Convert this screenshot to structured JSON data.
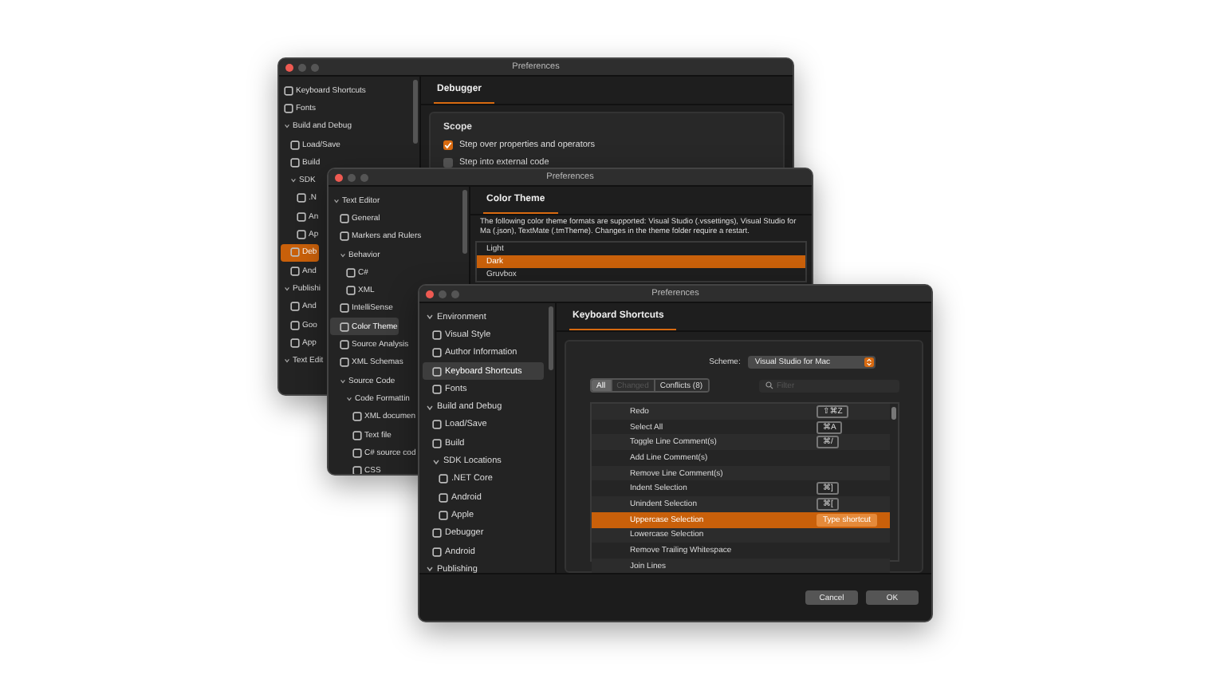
{
  "windows": [
    {
      "title": "Preferences",
      "sidebar": [
        {
          "label": "Keyboard Shortcuts",
          "selected": false
        },
        {
          "label": "Fonts",
          "selected": false
        },
        {
          "label": "Build and Debug",
          "selected": false,
          "expanded": true,
          "children": [
            {
              "label": "Load/Save",
              "selected": false
            },
            {
              "label": "Build",
              "selected": false
            },
            {
              "label": "SDK",
              "selected": false,
              "expanded": true,
              "children": [
                {
                  "label": ".N",
                  "selected": false
                },
                {
                  "label": "An",
                  "selected": false
                },
                {
                  "label": "Ap",
                  "selected": false
                }
              ]
            },
            {
              "label": "Deb",
              "selected": true
            },
            {
              "label": "And",
              "selected": false
            }
          ]
        },
        {
          "label": "Publishi",
          "selected": false,
          "expanded": true,
          "children": [
            {
              "label": "And",
              "selected": false
            },
            {
              "label": "Goo",
              "selected": false
            },
            {
              "label": "App",
              "selected": false
            }
          ]
        },
        {
          "label": "Text Edit",
          "selected": false,
          "expanded": true
        }
      ],
      "page": {
        "kind": "options",
        "tab": "Debugger",
        "section": "Scope",
        "options": [
          {
            "label": "Step over properties and operators",
            "checked": true
          },
          {
            "label": "Step into external code",
            "checked": false
          }
        ]
      }
    },
    {
      "title": "Preferences",
      "sidebar": [
        {
          "label": "Text Editor",
          "selected": false,
          "expanded": true,
          "children": [
            {
              "label": "General",
              "selected": false
            },
            {
              "label": "Markers and Rulers",
              "selected": false
            },
            {
              "label": "Behavior",
              "selected": false,
              "expanded": true,
              "children": [
                {
                  "label": "C#",
                  "selected": false
                },
                {
                  "label": "XML",
                  "selected": false
                }
              ]
            },
            {
              "label": "IntelliSense",
              "selected": false
            },
            {
              "label": "Color Theme",
              "selected": true
            },
            {
              "label": "Source Analysis",
              "selected": false
            },
            {
              "label": "XML Schemas",
              "selected": false
            },
            {
              "label": "Source Code",
              "selected": false,
              "expanded": true,
              "children": [
                {
                  "label": "Code Formattin",
                  "selected": false,
                  "expanded": true,
                  "children": [
                    {
                      "label": "XML documen",
                      "selected": false
                    },
                    {
                      "label": "Text file",
                      "selected": false
                    },
                    {
                      "label": "C# source cod",
                      "selected": false
                    },
                    {
                      "label": "CSS",
                      "selected": false
                    }
                  ]
                }
              ]
            }
          ]
        }
      ],
      "page": {
        "kind": "theme",
        "tab": "Color Theme",
        "description": "The following color theme formats are supported: Visual Studio (.vssettings), Visual Studio for Ma (.json), TextMate (.tmTheme). Changes in the theme folder require a restart.",
        "themes": [
          {
            "label": "Light",
            "selected": false
          },
          {
            "label": "Dark",
            "selected": true
          },
          {
            "label": "Gruvbox",
            "selected": false
          }
        ]
      }
    },
    {
      "title": "Preferences",
      "sidebar": [
        {
          "label": "Environment",
          "selected": false,
          "expanded": true,
          "children": [
            {
              "label": "Visual Style",
              "selected": false
            },
            {
              "label": "Author Information",
              "selected": false
            },
            {
              "label": "Keyboard Shortcuts",
              "selected": true
            },
            {
              "label": "Fonts",
              "selected": false
            }
          ]
        },
        {
          "label": "Build and Debug",
          "selected": false,
          "expanded": true,
          "children": [
            {
              "label": "Load/Save",
              "selected": false
            },
            {
              "label": "Build",
              "selected": false
            },
            {
              "label": "SDK Locations",
              "selected": false,
              "expanded": true,
              "children": [
                {
                  "label": ".NET Core",
                  "selected": false
                },
                {
                  "label": "Android",
                  "selected": false
                },
                {
                  "label": "Apple",
                  "selected": false
                }
              ]
            },
            {
              "label": "Debugger",
              "selected": false
            },
            {
              "label": "Android",
              "selected": false
            }
          ]
        },
        {
          "label": "Publishing",
          "selected": false,
          "expanded": true
        }
      ],
      "page": {
        "kind": "shortcuts",
        "tab": "Keyboard Shortcuts",
        "scheme_label": "Scheme:",
        "scheme": "Visual Studio for Mac",
        "filters": [
          {
            "label": "All",
            "selected": true,
            "disabled": false
          },
          {
            "label": "Changed",
            "selected": false,
            "disabled": true
          },
          {
            "label": "Conflicts (8)",
            "selected": false,
            "disabled": false
          }
        ],
        "filter_placeholder": "Filter",
        "commands": [
          {
            "name": "Redo",
            "shortcut": "⇧⌘Z",
            "selected": false
          },
          {
            "name": "Select All",
            "shortcut": "⌘A",
            "selected": false
          },
          {
            "name": "Toggle Line Comment(s)",
            "shortcut": "⌘/",
            "selected": false
          },
          {
            "name": "Add Line Comment(s)",
            "selected": false
          },
          {
            "name": "Remove Line Comment(s)",
            "selected": false
          },
          {
            "name": "Indent Selection",
            "shortcut": "⌘]",
            "selected": false
          },
          {
            "name": "Unindent Selection",
            "shortcut": "⌘[",
            "selected": false
          },
          {
            "name": "Uppercase Selection",
            "shortcut": "Type shortcut",
            "selected": true
          },
          {
            "name": "Lowercase Selection",
            "selected": false
          },
          {
            "name": "Remove Trailing Whitespace",
            "selected": false
          },
          {
            "name": "Join Lines",
            "selected": false
          }
        ],
        "buttons": [
          "Cancel",
          "OK"
        ]
      }
    }
  ]
}
